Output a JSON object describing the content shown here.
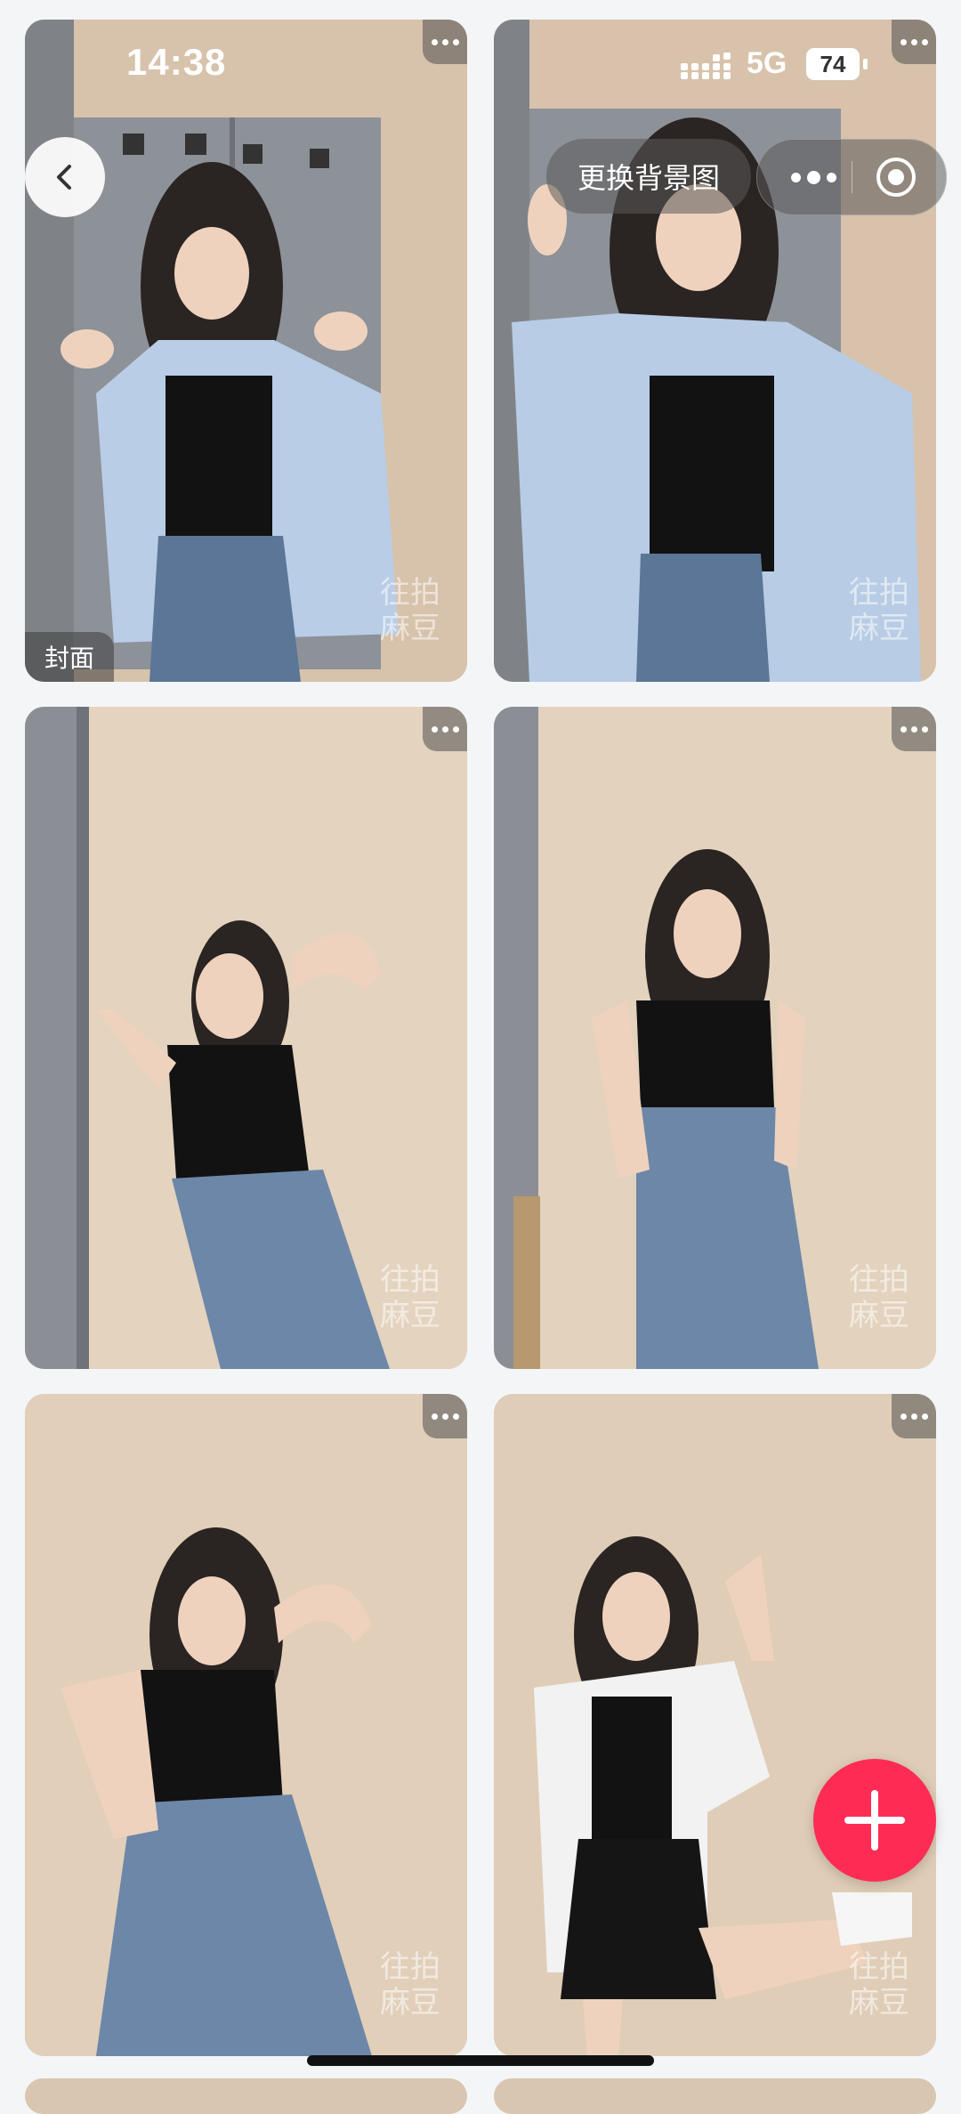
{
  "status_bar": {
    "time": "14:38",
    "network": "5G",
    "battery": "74"
  },
  "nav": {
    "change_background_label": "更换背景图"
  },
  "gallery": {
    "cover_label": "封面",
    "watermark_line1": "往拍",
    "watermark_line2": "麻豆"
  },
  "colors": {
    "accent": "#fe2c55",
    "page_bg": "#f4f5f7",
    "wall": "#d8c6b0"
  },
  "icons": [
    "back-icon",
    "more-dots-icon",
    "close-capsule-icon",
    "plus-icon",
    "signal-icon"
  ]
}
